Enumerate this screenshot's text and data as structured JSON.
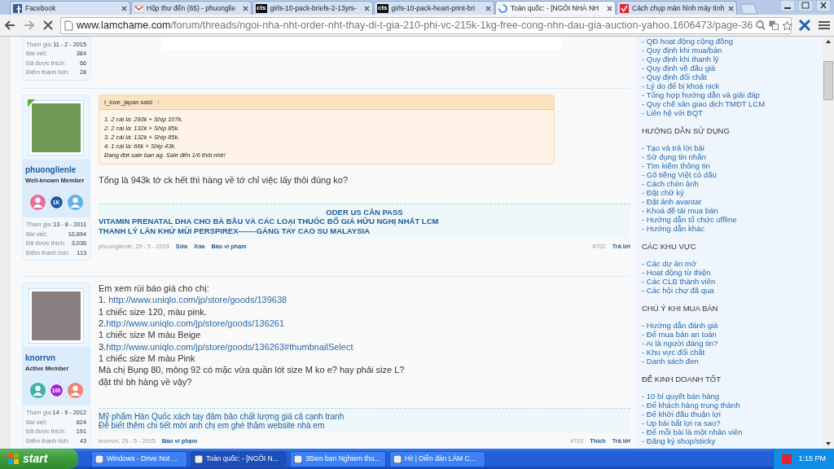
{
  "browser": {
    "tabs": [
      {
        "title": "Facebook",
        "kind": "facebook",
        "selected": false
      },
      {
        "title": "Hộp thư đến (65) - phuonglie",
        "kind": "mail",
        "selected": false
      },
      {
        "title": "girls-10-pack-briefs-2-13yrs-",
        "kind": "text",
        "icon_text": "cts",
        "selected": false
      },
      {
        "title": "girls-10-pack-heart-print-bri",
        "kind": "text",
        "icon_text": "cts",
        "selected": false
      },
      {
        "title": "Toàn quốc: - [NGÔI NHÀ NH",
        "kind": "loading",
        "selected": true
      },
      {
        "title": "Cách chụp màn hình máy tính",
        "kind": "check",
        "selected": false
      }
    ],
    "url_host": "www.lamchame.com",
    "url_path": "/forum/threads/ngoi-nha-nht-order-nht-thay-di-t-gia-210-phi-vc-215k-1kg-free-cong-nhn-dau-gia-auction-yahoo.1606473/page-36"
  },
  "previous_post": {
    "stats": [
      {
        "label": "Tham gia:",
        "value": "11 - 2 - 2015"
      },
      {
        "label": "Bài viết:",
        "value": "384"
      },
      {
        "label": "Đã được thích:",
        "value": "66"
      },
      {
        "label": "Điểm thành tích:",
        "value": "28"
      }
    ]
  },
  "posts": [
    {
      "user": {
        "name": "phuonglienle",
        "title": "Well-known Member",
        "online": true,
        "badges": [
          {
            "kind": "person",
            "color": "#e86f9c"
          },
          {
            "kind": "count",
            "text": "1K",
            "color": "#1d5fa8"
          },
          {
            "kind": "person",
            "color": "#5db3e8"
          }
        ],
        "stats": [
          {
            "label": "Tham gia:",
            "value": "13 - 8 - 2011"
          },
          {
            "label": "Bài viết:",
            "value": "10,894"
          },
          {
            "label": "Đã được thích:",
            "value": "3,036"
          },
          {
            "label": "Điểm thành tích:",
            "value": "113"
          }
        ]
      },
      "quote": {
        "author": "I_love_japan said:",
        "jump": "↑",
        "lines": [
          "1. 2 cái là: 293k + Ship 107k.",
          "2. 2 cái là: 132k + Ship 85k.",
          "3. 2 cái là: 132k + Ship 85k.",
          "4. 1 cái là: 66k + Ship 43k.",
          "Đang đợt sale bạn ag. Sale đến 1/6 thôi nhé!"
        ]
      },
      "body": [
        {
          "text": "Tổng là 943k tớ ck hết thì hàng về tớ chỉ việc lấy thôi đúng ko?"
        }
      ],
      "signature": {
        "kind": "banner",
        "headline": "ODER US CẦN PASS",
        "lines": [
          "VITAMIN PRENATAL DHA CHO BÀ BẦU VÀ CÁC LOẠI THUỐC BỔ GIÁ HỮU NGHỊ NHẤT LCM",
          "THANH LÝ LĂN KHỬ MÙI PERSPIREX-------GĂNG TAY CAO SU MALAYSIA"
        ]
      },
      "footer": {
        "byline": "phuonglienle, 29 - 5 - 2015",
        "actions": [
          "Sửa",
          "Xóa",
          "Báo vi phạm"
        ],
        "number": "#702",
        "right_actions": [
          "Trả lời"
        ]
      }
    },
    {
      "user": {
        "name": "knorrvn",
        "title": "Active Member",
        "online": false,
        "badges": [
          {
            "kind": "person",
            "color": "#3fb3a3"
          },
          {
            "kind": "count",
            "text": "100",
            "color": "#9b2ad6"
          },
          {
            "kind": "person",
            "color": "#ee8670"
          }
        ],
        "stats": [
          {
            "label": "Tham gia:",
            "value": "14 - 9 - 2012"
          },
          {
            "label": "Bài viết:",
            "value": "824"
          },
          {
            "label": "Đã được thích:",
            "value": "191"
          },
          {
            "label": "Điểm thành tích:",
            "value": "43"
          }
        ]
      },
      "body": [
        {
          "text": "Em xem rùi báo giá cho chị:"
        },
        {
          "text": "1. ",
          "link": "http://www.uniqlo.com/jp/store/goods/139638"
        },
        {
          "text": "1 chiếc size 120, màu pink."
        },
        {
          "text": "2.",
          "link": "http://www.uniqlo.com/jp/store/goods/136261"
        },
        {
          "text": "1 chiếc size M màu Beige"
        },
        {
          "text": "3.",
          "link": "http://www.uniqlo.com/jp/store/goods/136263#thumbnailSelect"
        },
        {
          "text": "1 chiếc size M màu Pink"
        },
        {
          "text": "Mà chị Bụng 80, mông 92 có mặc vừa quần lót size M ko e? hay phải size L?"
        },
        {
          "text": "đặt thì bh hàng về vậy?"
        }
      ],
      "signature": {
        "kind": "plain",
        "lines": [
          "Mỹ phẩm Hàn Quốc xách tay đảm bảo chất lượng giá cả cạnh tranh",
          "Để biết thêm chi tiết mời anh chị em ghé thăm website nhà em"
        ]
      },
      "footer": {
        "byline": "knorrvn, 29 - 5 - 2015",
        "actions": [
          "Báo vi phạm"
        ],
        "number": "#703",
        "right_actions": [
          "Thích",
          "Trả lời"
        ]
      }
    }
  ],
  "sidebar": {
    "sections": [
      {
        "items": [
          "- QĐ hoạt động cộng đồng",
          "- Quy định khi mua/bán",
          "- Quy định khi thanh lý",
          "- Quy định về đấu giá",
          "- Quy định đổi chất",
          "- Lý do để bị khoá nick",
          "- Tổng hợp hướng dẫn và giải đáp",
          "- Quy chế sàn giao dịch TMĐT LCM",
          "- Liên hệ với BQT"
        ]
      },
      {
        "heading": "HƯỚNG DẪN SỬ DỤNG",
        "items": [
          "- Tạo và trả lời bài",
          "- Sử dụng tin nhắn",
          "- Tìm kiếm thông tin",
          "- Gõ tiếng Việt có dấu",
          "- Cách chèn ảnh",
          "- Đặt chữ ký",
          "- Đặt ảnh avantar",
          "- Khoá đề tài mua bán",
          "- Hướng dẫn tổ chức offline",
          "- Hướng dẫn khác"
        ]
      },
      {
        "heading": "CÁC KHU VỰC",
        "items": [
          "- Các dự án mở",
          "- Hoạt động từ thiện",
          "- Các CLB thành viên",
          "- Các hội chợ đã qua"
        ]
      },
      {
        "heading": "CHÚ Ý KHI MUA BÁN",
        "items": [
          "- Hướng dẫn đánh giá",
          "- Để mua bán an toàn",
          "- Ai là người đáng tin?",
          "- Khu vực đổi chất",
          "- Danh sách đen"
        ]
      },
      {
        "heading": "ĐỂ KINH DOANH TỐT",
        "items": [
          "- 10 bí quyết bán hàng",
          "- Để khách hàng trung thành",
          "- Để khởi đầu thuận lợi",
          "- Up bài bắt lợi ra sao?",
          "- Để mỗi bài là một nhân viên",
          "- Đăng ký shop/sticky"
        ]
      }
    ]
  },
  "taskbar": {
    "start": "start",
    "items": [
      {
        "label": "Windows - Drive Not ...",
        "selected": false
      },
      {
        "label": "Toàn quốc: - [NGÔI N...",
        "selected": true
      },
      {
        "label": "3Bien ban Nghiem thu...",
        "selected": false
      },
      {
        "label": "Hi! | Diễn đàn LÀM C...",
        "selected": false
      }
    ],
    "clock": "1:15 PM"
  }
}
